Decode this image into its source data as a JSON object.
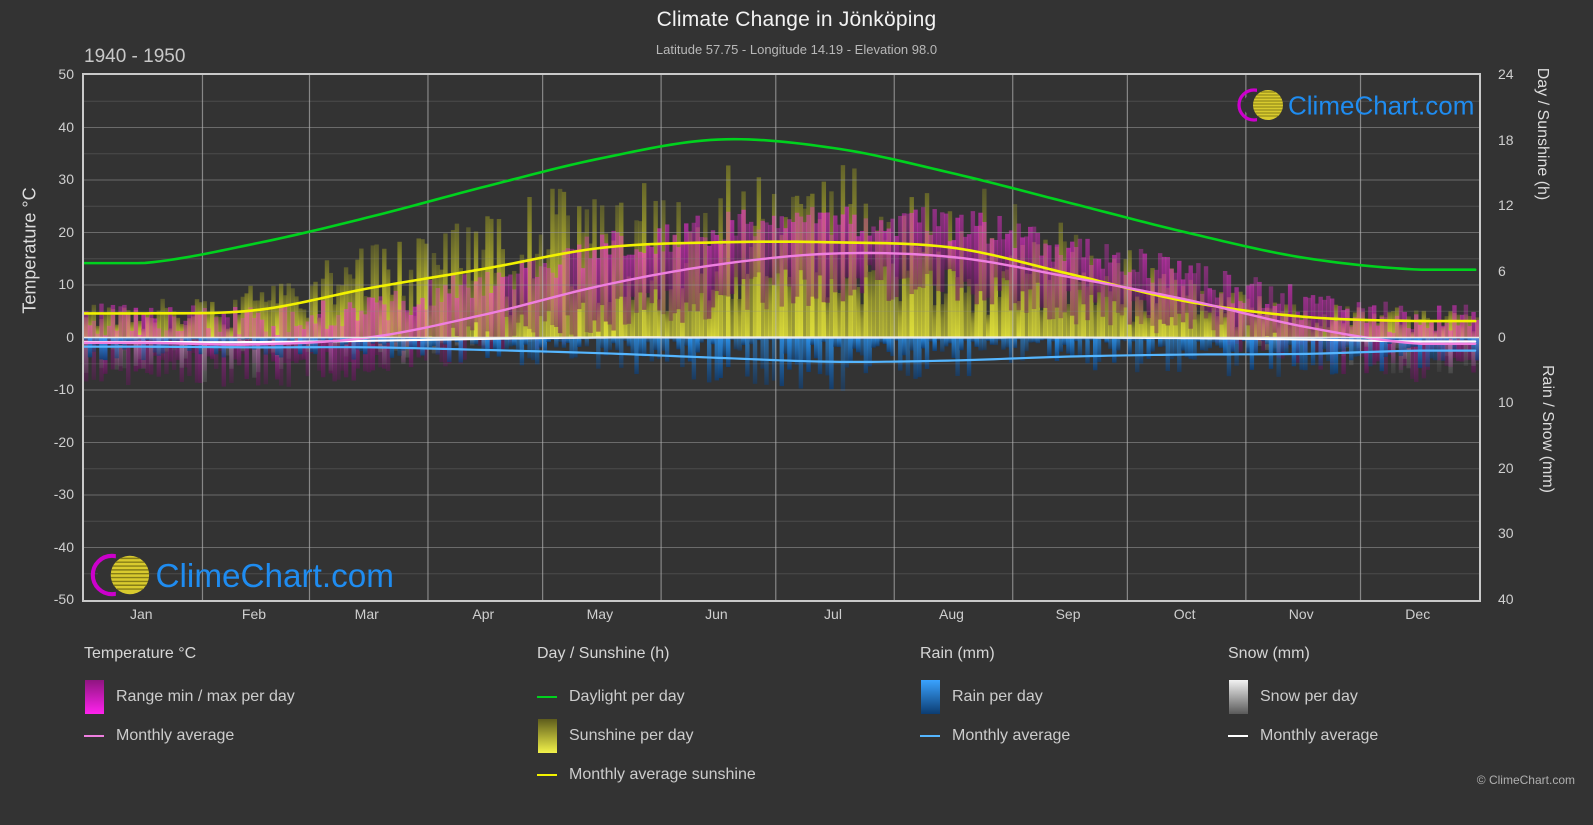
{
  "header": {
    "title": "Climate Change in Jönköping",
    "subtitle": "Latitude 57.75 - Longitude 14.19 - Elevation 98.0",
    "period": "1940 - 1950"
  },
  "branding": {
    "logo_text": "ClimeChart.com",
    "copyright": "© ClimeChart.com",
    "colors": {
      "brand_blue": "#1f8cf0",
      "crescent_magenta": "#cc00cc",
      "ball_yellow": "#d6c832"
    }
  },
  "axes": {
    "left": {
      "label": "Temperature °C",
      "ticks": [
        50,
        40,
        30,
        20,
        10,
        0,
        -10,
        -20,
        -30,
        -40,
        -50
      ],
      "min": -50,
      "max": 50
    },
    "right_top": {
      "label": "Day / Sunshine (h)",
      "ticks": [
        24,
        18,
        12,
        6,
        0
      ],
      "min": 0,
      "max": 24
    },
    "right_bottom": {
      "label": "Rain / Snow (mm)",
      "ticks": [
        0,
        10,
        20,
        30,
        40
      ],
      "min": 0,
      "max": 40
    },
    "x": {
      "labels": [
        "Jan",
        "Feb",
        "Mar",
        "Apr",
        "May",
        "Jun",
        "Jul",
        "Aug",
        "Sep",
        "Oct",
        "Nov",
        "Dec"
      ]
    }
  },
  "legend": {
    "columns": [
      {
        "title": "Temperature °C",
        "items": [
          {
            "label": "Range min / max per day",
            "marker": "gradient-box",
            "color": "#ff00ff"
          },
          {
            "label": "Monthly average",
            "marker": "line",
            "color": "#ef7fe0"
          }
        ]
      },
      {
        "title": "Day / Sunshine (h)",
        "items": [
          {
            "label": "Daylight per day",
            "marker": "line",
            "color": "#00d21e"
          },
          {
            "label": "Sunshine per day",
            "marker": "gradient-box",
            "color": "#e8e832"
          },
          {
            "label": "Monthly average sunshine",
            "marker": "line",
            "color": "#f2f200"
          }
        ]
      },
      {
        "title": "Rain (mm)",
        "items": [
          {
            "label": "Rain per day",
            "marker": "gradient-box",
            "color": "#1e90ff"
          },
          {
            "label": "Monthly average",
            "marker": "line",
            "color": "#55b6ff"
          }
        ]
      },
      {
        "title": "Snow (mm)",
        "items": [
          {
            "label": "Snow per day",
            "marker": "gradient-box",
            "color": "#e6e6e6"
          },
          {
            "label": "Monthly average",
            "marker": "line",
            "color": "#ffffff"
          }
        ]
      }
    ]
  },
  "chart_data": {
    "type": "area",
    "title": "Climate Change in Jönköping",
    "subtitle": "Latitude 57.75 - Longitude 14.19 - Elevation 98.0",
    "period": "1940 - 1950",
    "xlabel": "",
    "ylabel": "Temperature °C",
    "ylim": [
      -50,
      50
    ],
    "y2lim_day_sunshine": [
      0,
      24
    ],
    "y2lim_rain_snow": [
      0,
      40
    ],
    "grid": true,
    "legend_position": "below",
    "categories": [
      "Jan",
      "Feb",
      "Mar",
      "Apr",
      "May",
      "Jun",
      "Jul",
      "Aug",
      "Sep",
      "Oct",
      "Nov",
      "Dec"
    ],
    "series": [
      {
        "name": "Daylight per day",
        "unit": "h",
        "axis": "right_top",
        "color": "#00d21e",
        "values": [
          6.8,
          8.6,
          11.0,
          13.8,
          16.4,
          18.1,
          17.3,
          15.0,
          12.3,
          9.6,
          7.3,
          6.2
        ]
      },
      {
        "name": "Monthly average sunshine",
        "unit": "h",
        "axis": "right_top",
        "color": "#f2f200",
        "values": [
          2.2,
          2.5,
          4.5,
          6.3,
          8.2,
          8.7,
          8.7,
          8.2,
          5.8,
          3.3,
          1.9,
          1.5
        ]
      },
      {
        "name": "Monthly average temperature",
        "unit": "°C",
        "axis": "left",
        "color": "#ef7fe0",
        "values": [
          -1.0,
          -1.3,
          0.0,
          4.4,
          9.9,
          13.9,
          16.0,
          15.3,
          11.5,
          7.2,
          2.1,
          -1.2
        ]
      },
      {
        "name": "Rain monthly average",
        "unit": "mm",
        "axis": "right_bottom",
        "color": "#55b6ff",
        "values": [
          1.4,
          1.5,
          1.5,
          1.9,
          2.4,
          3.1,
          3.7,
          3.5,
          2.9,
          2.6,
          2.5,
          2.0
        ]
      },
      {
        "name": "Snow monthly average",
        "unit": "mm",
        "axis": "right_bottom",
        "color": "#ffffff",
        "values": [
          0.7,
          0.7,
          0.5,
          0.2,
          0.0,
          0.0,
          0.0,
          0.0,
          0.0,
          0.1,
          0.3,
          0.6
        ]
      },
      {
        "name": "Temperature range max per day",
        "unit": "°C",
        "axis": "left",
        "color": "#ff00ff",
        "values": [
          3.0,
          2.6,
          5.0,
          10.5,
          16.5,
          20.5,
          22.0,
          21.0,
          16.5,
          11.5,
          6.0,
          3.0
        ]
      },
      {
        "name": "Temperature range min per day",
        "unit": "°C",
        "axis": "left",
        "color": "#ff00ff",
        "values": [
          -5.0,
          -5.5,
          -4.0,
          0.0,
          4.0,
          8.0,
          10.5,
          10.0,
          6.5,
          3.0,
          -1.5,
          -5.0
        ]
      },
      {
        "name": "Sunshine per day",
        "unit": "h",
        "axis": "right_top",
        "color": "#c8c832",
        "values": [
          2.2,
          3.0,
          5.0,
          7.0,
          9.0,
          9.5,
          9.3,
          8.5,
          6.0,
          3.5,
          2.0,
          1.6
        ]
      },
      {
        "name": "Rain per day",
        "unit": "mm",
        "axis": "right_bottom",
        "color": "#1e90ff",
        "values": [
          1.5,
          1.4,
          1.5,
          1.9,
          2.5,
          3.2,
          3.8,
          3.6,
          3.0,
          2.7,
          2.6,
          2.1
        ]
      },
      {
        "name": "Snow per day",
        "unit": "mm",
        "axis": "right_bottom",
        "color": "#d0d0d0",
        "values": [
          2.5,
          2.4,
          1.8,
          0.6,
          0.0,
          0.0,
          0.0,
          0.0,
          0.0,
          0.3,
          1.1,
          2.2
        ]
      }
    ]
  }
}
